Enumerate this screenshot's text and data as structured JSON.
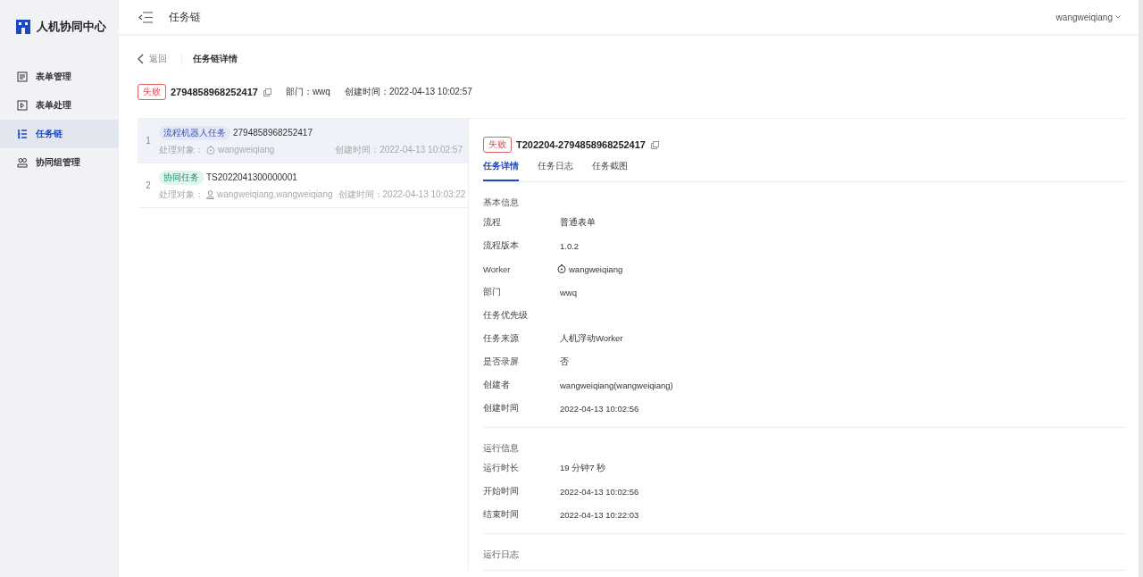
{
  "app": {
    "title": "人机协同中心"
  },
  "sidebar": {
    "items": [
      {
        "label": "表单管理",
        "selected": false
      },
      {
        "label": "表单处理",
        "selected": false
      },
      {
        "label": "任务链",
        "selected": true
      },
      {
        "label": "协同组管理",
        "selected": false
      }
    ]
  },
  "header": {
    "title": "任务链",
    "user": "wangweiqiang"
  },
  "breadcrumb": {
    "back": "返回",
    "current": "任务链详情"
  },
  "summary": {
    "status": "失败",
    "id": "2794858968252417",
    "dept_label": "部门：",
    "dept": "wwq",
    "created_label": "创建时间：",
    "created": "2022-04-13 10:02:57"
  },
  "tasks": [
    {
      "index": "1",
      "kind": "robot",
      "tag": "流程机器人任务",
      "id": "2794858968252417",
      "target_label": "处理对象：",
      "target": "wangweiqiang",
      "created_label": "创建时间：",
      "created": "2022-04-13 10:02:57",
      "selected": true
    },
    {
      "index": "2",
      "kind": "collab",
      "tag": "协同任务",
      "id": "TS2022041300000001",
      "target_label": "处理对象：",
      "target": "wangweiqiang,wangweiqiang",
      "created_label": "创建时间：",
      "created": "2022-04-13 10:03:22",
      "selected": false
    }
  ],
  "detail": {
    "status": "失败",
    "title": "T202204-2794858968252417",
    "tabs": [
      {
        "label": "任务详情",
        "selected": true
      },
      {
        "label": "任务日志",
        "selected": false
      },
      {
        "label": "任务截图",
        "selected": false
      }
    ],
    "sections": [
      {
        "title": "基本信息",
        "fields": [
          {
            "label": "流程",
            "value": "普通表单"
          },
          {
            "label": "流程版本",
            "value": "1.0.2"
          },
          {
            "label": "Worker",
            "value": "wangweiqiang",
            "kind": "robot"
          },
          {
            "label": "部门",
            "value": "wwq"
          },
          {
            "label": "任务优先级"
          },
          {
            "label": "任务来源",
            "value": "人机浮动Worker"
          },
          {
            "label": "是否录屏",
            "value": "否"
          },
          {
            "label": "创建者",
            "value": "wangweiqiang(wangweiqiang)"
          },
          {
            "label": "创建时间",
            "value": "2022-04-13 10:02:56"
          }
        ]
      },
      {
        "title": "运行信息",
        "fields": [
          {
            "label": "运行时长",
            "value": "19 分钟7 秒"
          },
          {
            "label": "开始时间",
            "value": "2022-04-13 10:02:56"
          },
          {
            "label": "结束时间",
            "value": "2022-04-13 10:22:03"
          }
        ]
      },
      {
        "title": "运行日志"
      }
    ]
  }
}
